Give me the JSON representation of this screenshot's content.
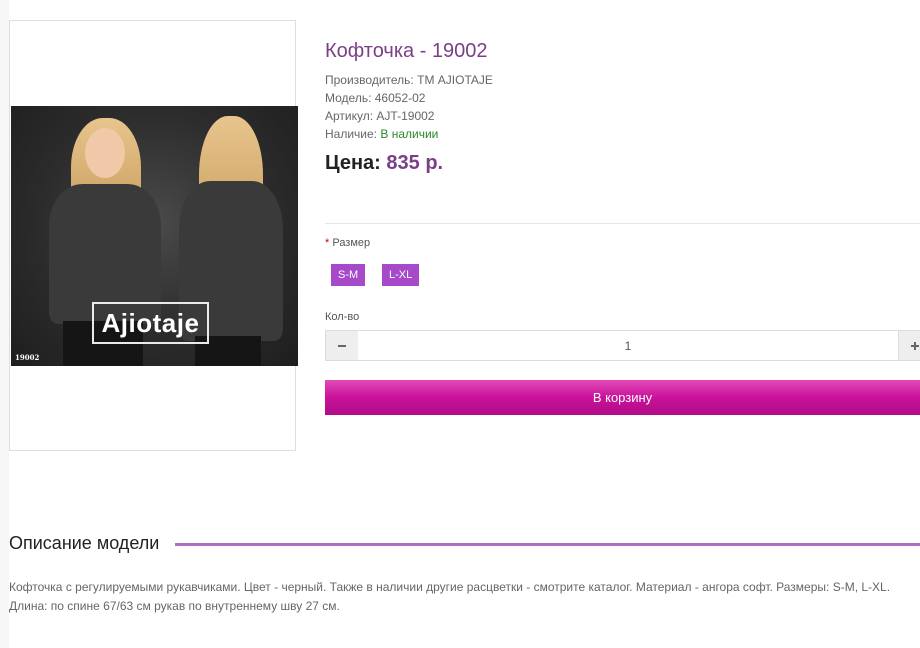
{
  "product": {
    "title": "Кофточка - 19002",
    "manufacturer_label": "Производитель:",
    "manufacturer": "ТМ AJIOTAJE",
    "model_label": "Модель:",
    "model": "46052-02",
    "sku_label": "Артикул:",
    "sku": "AJT-19002",
    "stock_label": "Наличие:",
    "stock": "В наличии",
    "price_label": "Цена:",
    "price": "835 р."
  },
  "image": {
    "logo_text": "Ajiotaje",
    "code": "19002"
  },
  "options": {
    "size_required_mark": "*",
    "size_label": "Размер",
    "sizes": [
      "S-M",
      "L-XL"
    ],
    "qty_label": "Кол-во",
    "qty_value": "1",
    "minus_icon": "minus-icon",
    "plus_icon": "plus-icon"
  },
  "cart_button": "В корзину",
  "description": {
    "heading": "Описание модели",
    "text": "Кофточка с регулируемыми рукавчиками. Цвет - черный. Также в наличии другие расцветки - смотрите каталог. Материал - ангора софт. Размеры: S-M, L-XL. Длина: по спине 67/63 см рукав по внутреннему шву 27 см.",
    "accent_color": "#b06ec0"
  },
  "colors": {
    "title": "#7b3f88",
    "size_button": "#a64ac9",
    "cart_button": "#c8129a",
    "in_stock": "#2a8a2a"
  }
}
